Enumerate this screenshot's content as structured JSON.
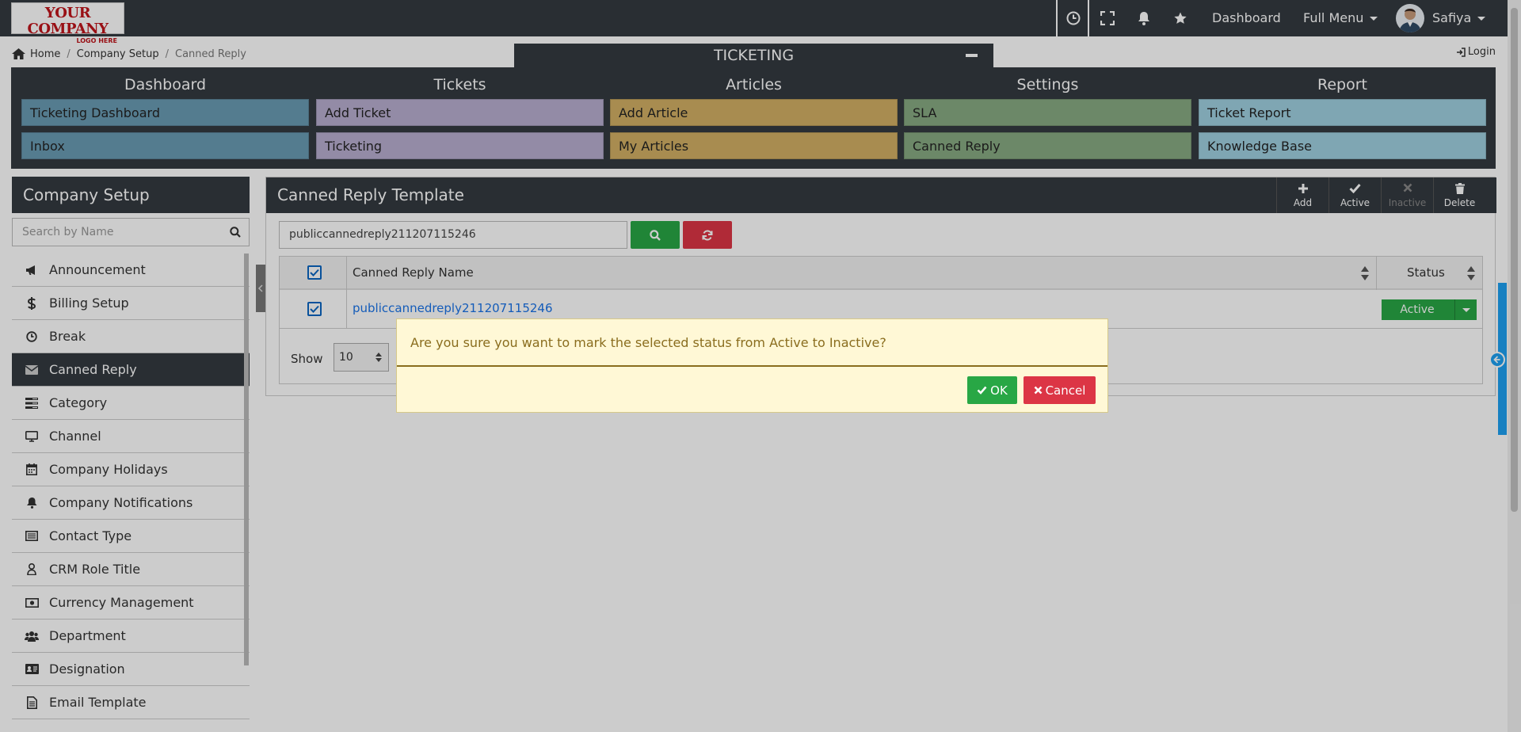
{
  "topbar": {
    "logo_line1": "YOUR COMPANY",
    "logo_line2": "LOGO HERE",
    "icons": [
      "clock-icon",
      "fullscreen-icon",
      "bell-icon",
      "star-icon"
    ],
    "dashboard_label": "Dashboard",
    "full_menu_label": "Full Menu",
    "user_name": "Safiya"
  },
  "breadcrumb": [
    "Home",
    "Company Setup",
    "Canned Reply"
  ],
  "ticketing_tab": "TICKETING",
  "login_label": "Login",
  "menu": {
    "columns": [
      {
        "heading": "Dashboard",
        "items": [
          "Ticketing Dashboard",
          "Inbox"
        ],
        "color": "#6a9bb3"
      },
      {
        "heading": "Tickets",
        "items": [
          "Add Ticket",
          "Ticketing"
        ],
        "color": "#b8aed0"
      },
      {
        "heading": "Articles",
        "items": [
          "Add Article",
          "My Articles"
        ],
        "color": "#d2b064"
      },
      {
        "heading": "Settings",
        "items": [
          "SLA",
          "Canned Reply"
        ],
        "color": "#88aa82"
      },
      {
        "heading": "Report",
        "items": [
          "Ticket Report",
          "Knowledge Base"
        ],
        "color": "#9fd0e0"
      }
    ]
  },
  "sidebar": {
    "title": "Company Setup",
    "search_placeholder": "Search by Name",
    "items": [
      {
        "label": "Announcement",
        "icon": "megaphone-icon"
      },
      {
        "label": "Billing Setup",
        "icon": "dollar-icon"
      },
      {
        "label": "Break",
        "icon": "clock-icon"
      },
      {
        "label": "Canned Reply",
        "icon": "envelope-icon",
        "active": true
      },
      {
        "label": "Category",
        "icon": "category-icon"
      },
      {
        "label": "Channel",
        "icon": "monitor-icon"
      },
      {
        "label": "Company Holidays",
        "icon": "calendar-icon"
      },
      {
        "label": "Company Notifications",
        "icon": "bell-icon"
      },
      {
        "label": "Contact Type",
        "icon": "contact-card-icon"
      },
      {
        "label": "CRM Role Title",
        "icon": "user-icon"
      },
      {
        "label": "Currency Management",
        "icon": "money-icon"
      },
      {
        "label": "Department",
        "icon": "users-icon"
      },
      {
        "label": "Designation",
        "icon": "id-card-icon"
      },
      {
        "label": "Email Template",
        "icon": "file-icon"
      }
    ]
  },
  "main": {
    "title": "Canned Reply Template",
    "toolbar": [
      {
        "label": "Add",
        "icon": "plus-icon",
        "enabled": true
      },
      {
        "label": "Active",
        "icon": "check-icon",
        "enabled": true
      },
      {
        "label": "Inactive",
        "icon": "times-icon",
        "enabled": false
      },
      {
        "label": "Delete",
        "icon": "trash-icon",
        "enabled": true
      }
    ],
    "search_value": "publiccannedreply211207115246",
    "table": {
      "columns": [
        "Canned Reply Name",
        "Status"
      ],
      "rows": [
        {
          "name": "publiccannedreply211207115246",
          "status": "Active",
          "checked": true
        }
      ]
    },
    "show_label": "Show",
    "show_value": "10"
  },
  "dialog": {
    "message": "Are you sure you want to mark the selected status from Active to Inactive?",
    "ok_label": "OK",
    "cancel_label": "Cancel"
  },
  "colors": {
    "dark": "#343a40",
    "success": "#28a745",
    "danger": "#dc3545",
    "link": "#1a73e8",
    "dialog_bg": "#fff8d6"
  }
}
